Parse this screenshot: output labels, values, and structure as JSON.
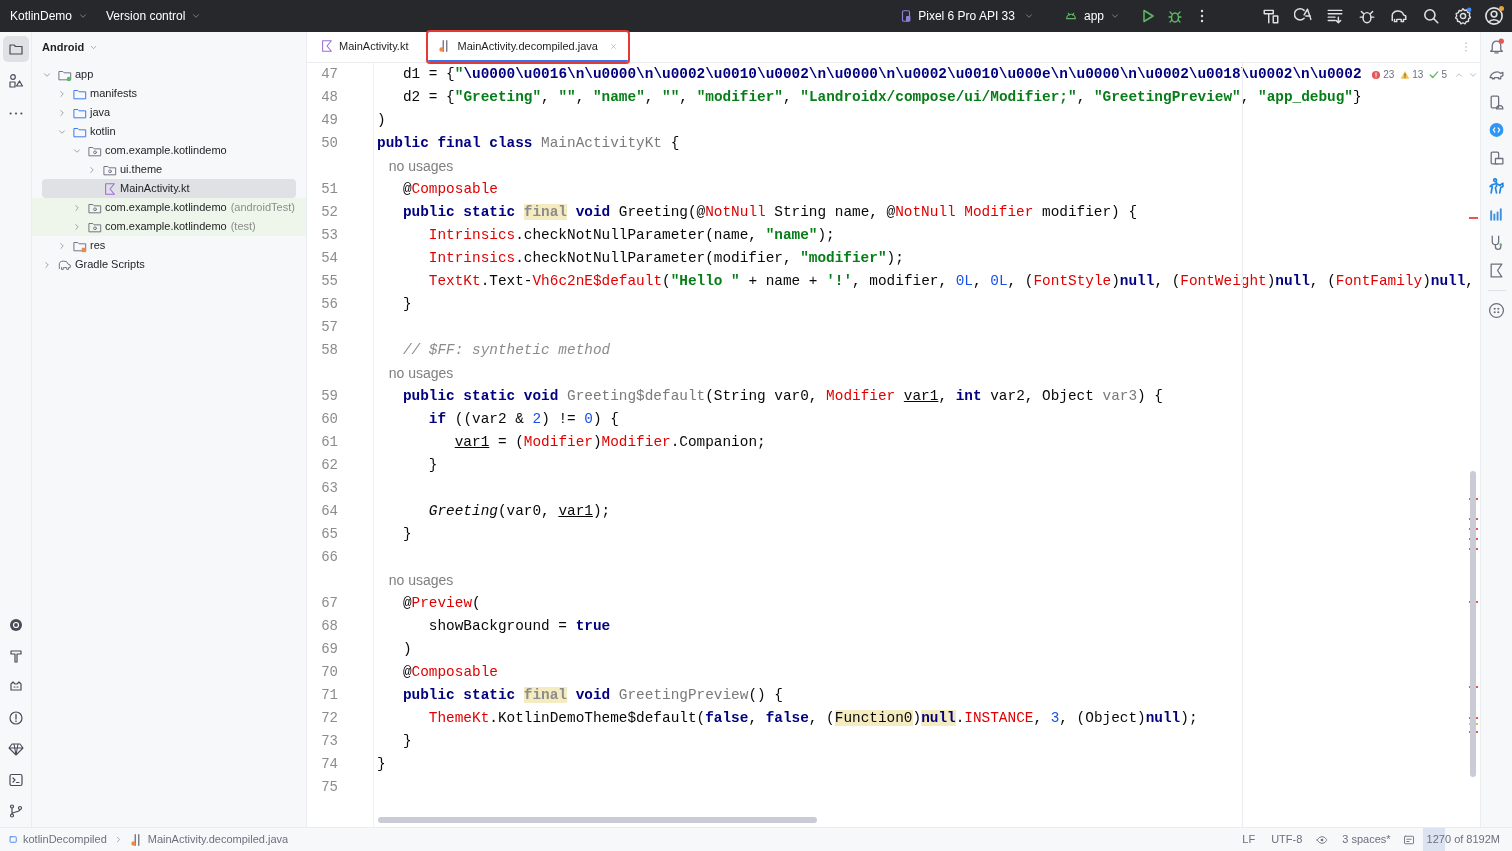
{
  "title_bar": {
    "project": "KotlinDemo",
    "vcs": "Version control",
    "device": "Pixel 6 Pro API 33",
    "run_config": "app"
  },
  "left_tools": [
    {
      "kind": "project",
      "selected": true
    },
    {
      "kind": "resources",
      "selected": false
    },
    {
      "kind": "more",
      "selected": false
    }
  ],
  "project_view": {
    "title": "Android",
    "tree": [
      {
        "label": "app",
        "kind": "module",
        "expanded": true,
        "selected": false,
        "test_source": false,
        "children": [
          {
            "label": "manifests",
            "kind": "folder",
            "expanded": false,
            "selected": false,
            "test_source": false
          },
          {
            "label": "java",
            "kind": "folder",
            "expanded": false,
            "selected": false,
            "test_source": false
          },
          {
            "label": "kotlin",
            "kind": "folder",
            "expanded": true,
            "selected": false,
            "test_source": false,
            "children": [
              {
                "label": "com.example.kotlindemo",
                "kind": "package",
                "expanded": true,
                "selected": false,
                "test_source": false,
                "children": [
                  {
                    "label": "ui.theme",
                    "kind": "package",
                    "expanded": false,
                    "selected": false,
                    "test_source": false
                  },
                  {
                    "label": "MainActivity.kt",
                    "kind": "kotlin-file",
                    "selected": true,
                    "test_source": false
                  }
                ]
              },
              {
                "label": "com.example.kotlindemo",
                "suffix": "(androidTest)",
                "kind": "package",
                "expanded": false,
                "selected": false,
                "test_source": true
              },
              {
                "label": "com.example.kotlindemo",
                "suffix": "(test)",
                "kind": "package",
                "expanded": false,
                "selected": false,
                "test_source": true
              }
            ]
          },
          {
            "label": "res",
            "kind": "res-folder",
            "expanded": false,
            "selected": false,
            "test_source": false
          }
        ]
      },
      {
        "label": "Gradle Scripts",
        "kind": "gradle",
        "expanded": false,
        "selected": false,
        "test_source": false
      }
    ]
  },
  "editor": {
    "tabs": [
      {
        "label": "MainActivity.kt",
        "kind": "kotlin-file",
        "selected": false,
        "outlined": false
      },
      {
        "label": "MainActivity.decompiled.java",
        "kind": "java-file",
        "selected": true,
        "outlined": true
      }
    ],
    "inspections": {
      "errors": "23",
      "warnings": "13",
      "weak_warnings": "5"
    },
    "lines": [
      {
        "kind": "code",
        "number": "47",
        "tokens": [
          {
            "kind": "plain",
            "text": "   d1 = {"
          },
          {
            "kind": "str",
            "text": "\""
          },
          {
            "kind": "esc",
            "text": "\\u0000\\u0016\\n\\u0000\\n\\u0002\\u0010\\u0002\\n\\u0000\\n\\u0002\\u0010\\u000e\\n\\u0000\\n\\u0002\\u0018\\u0002\\n\\u0002"
          }
        ]
      },
      {
        "kind": "code",
        "number": "48",
        "tokens": [
          {
            "kind": "plain",
            "text": "   d2 = {"
          },
          {
            "kind": "str",
            "text": "\"Greeting\""
          },
          {
            "kind": "plain",
            "text": ", "
          },
          {
            "kind": "str",
            "text": "\"\""
          },
          {
            "kind": "plain",
            "text": ", "
          },
          {
            "kind": "str",
            "text": "\"name\""
          },
          {
            "kind": "plain",
            "text": ", "
          },
          {
            "kind": "str",
            "text": "\"\""
          },
          {
            "kind": "plain",
            "text": ", "
          },
          {
            "kind": "str",
            "text": "\"modifier\""
          },
          {
            "kind": "plain",
            "text": ", "
          },
          {
            "kind": "str",
            "text": "\"Landroidx/compose/ui/Modifier;\""
          },
          {
            "kind": "plain",
            "text": ", "
          },
          {
            "kind": "str",
            "text": "\"GreetingPreview\""
          },
          {
            "kind": "plain",
            "text": ", "
          },
          {
            "kind": "str",
            "text": "\"app_debug\""
          },
          {
            "kind": "plain",
            "text": "}"
          }
        ]
      },
      {
        "kind": "code",
        "number": "49",
        "tokens": [
          {
            "kind": "plain",
            "text": ")"
          }
        ]
      },
      {
        "kind": "code",
        "number": "50",
        "tokens": [
          {
            "kind": "kw",
            "text": "public final class "
          },
          {
            "kind": "gray",
            "text": "MainActivityKt"
          },
          {
            "kind": "plain",
            "text": " {"
          }
        ]
      },
      {
        "kind": "hint",
        "text": "   no usages"
      },
      {
        "kind": "code",
        "number": "51",
        "tokens": [
          {
            "kind": "plain",
            "text": "   @"
          },
          {
            "kind": "ann",
            "text": "Composable"
          }
        ]
      },
      {
        "kind": "code",
        "number": "52",
        "tokens": [
          {
            "kind": "kw",
            "text": "   public static "
          },
          {
            "kind": "final-hl",
            "text": "final"
          },
          {
            "kind": "kw",
            "text": " void"
          },
          {
            "kind": "plain",
            "text": " Greeting(@"
          },
          {
            "kind": "ann",
            "text": "NotNull"
          },
          {
            "kind": "plain",
            "text": " String name, @"
          },
          {
            "kind": "ann",
            "text": "NotNull"
          },
          {
            "kind": "ann",
            "text": " Modifier"
          },
          {
            "kind": "plain",
            "text": " modifier) {"
          }
        ]
      },
      {
        "kind": "code",
        "number": "53",
        "tokens": [
          {
            "kind": "ann",
            "text": "      Intrinsics"
          },
          {
            "kind": "plain",
            "text": ".checkNotNullParameter(name, "
          },
          {
            "kind": "str",
            "text": "\"name\""
          },
          {
            "kind": "plain",
            "text": ");"
          }
        ]
      },
      {
        "kind": "code",
        "number": "54",
        "tokens": [
          {
            "kind": "ann",
            "text": "      Intrinsics"
          },
          {
            "kind": "plain",
            "text": ".checkNotNullParameter(modifier, "
          },
          {
            "kind": "str",
            "text": "\"modifier\""
          },
          {
            "kind": "plain",
            "text": ");"
          }
        ]
      },
      {
        "kind": "code",
        "number": "55",
        "tokens": [
          {
            "kind": "ann",
            "text": "      TextKt"
          },
          {
            "kind": "plain",
            "text": ".Text-"
          },
          {
            "kind": "ann",
            "text": "Vh6c2nE$default"
          },
          {
            "kind": "plain",
            "text": "("
          },
          {
            "kind": "str",
            "text": "\"Hello \""
          },
          {
            "kind": "plain",
            "text": " + name + "
          },
          {
            "kind": "str",
            "text": "'!'"
          },
          {
            "kind": "plain",
            "text": ", modifier, "
          },
          {
            "kind": "num",
            "text": "0L"
          },
          {
            "kind": "plain",
            "text": ", "
          },
          {
            "kind": "num",
            "text": "0L"
          },
          {
            "kind": "plain",
            "text": ", ("
          },
          {
            "kind": "ann",
            "text": "FontStyle"
          },
          {
            "kind": "plain",
            "text": ")"
          },
          {
            "kind": "kw",
            "text": "null"
          },
          {
            "kind": "plain",
            "text": ", ("
          },
          {
            "kind": "ann",
            "text": "FontWeight"
          },
          {
            "kind": "plain",
            "text": ")"
          },
          {
            "kind": "kw",
            "text": "null"
          },
          {
            "kind": "plain",
            "text": ", ("
          },
          {
            "kind": "ann",
            "text": "FontFamily"
          },
          {
            "kind": "plain",
            "text": ")"
          },
          {
            "kind": "kw",
            "text": "null"
          },
          {
            "kind": "plain",
            "text": ","
          }
        ]
      },
      {
        "kind": "code",
        "number": "56",
        "tokens": [
          {
            "kind": "plain",
            "text": "   }"
          }
        ]
      },
      {
        "kind": "code",
        "number": "57"
      },
      {
        "kind": "code",
        "number": "58",
        "tokens": [
          {
            "kind": "comment",
            "text": "   // $FF: synthetic method"
          }
        ]
      },
      {
        "kind": "hint",
        "text": "   no usages"
      },
      {
        "kind": "code",
        "number": "59",
        "tokens": [
          {
            "kind": "kw",
            "text": "   public static void "
          },
          {
            "kind": "gray",
            "text": "Greeting$default"
          },
          {
            "kind": "plain",
            "text": "(String var0, "
          },
          {
            "kind": "ann",
            "text": "Modifier"
          },
          {
            "kind": "var",
            "text": " var1"
          },
          {
            "kind": "plain",
            "text": ", "
          },
          {
            "kind": "kw",
            "text": "int"
          },
          {
            "kind": "plain",
            "text": " var2, Object "
          },
          {
            "kind": "gray",
            "text": "var3"
          },
          {
            "kind": "plain",
            "text": ") {"
          }
        ]
      },
      {
        "kind": "code",
        "number": "60",
        "tokens": [
          {
            "kind": "kw",
            "text": "      if"
          },
          {
            "kind": "plain",
            "text": " ((var2 & "
          },
          {
            "kind": "num",
            "text": "2"
          },
          {
            "kind": "plain",
            "text": ") != "
          },
          {
            "kind": "num",
            "text": "0"
          },
          {
            "kind": "plain",
            "text": ") {"
          }
        ]
      },
      {
        "kind": "code",
        "number": "61",
        "tokens": [
          {
            "kind": "var",
            "text": "         var1"
          },
          {
            "kind": "plain",
            "text": " = ("
          },
          {
            "kind": "ann",
            "text": "Modifier"
          },
          {
            "kind": "plain",
            "text": ")"
          },
          {
            "kind": "ann",
            "text": "Modifier"
          },
          {
            "kind": "plain",
            "text": ".Companion;"
          }
        ]
      },
      {
        "kind": "code",
        "number": "62",
        "tokens": [
          {
            "kind": "plain",
            "text": "      }"
          }
        ]
      },
      {
        "kind": "code",
        "number": "63"
      },
      {
        "kind": "code",
        "number": "64",
        "tokens": [
          {
            "kind": "italic",
            "text": "      Greeting"
          },
          {
            "kind": "plain",
            "text": "(var0, "
          },
          {
            "kind": "var",
            "text": "var1"
          },
          {
            "kind": "plain",
            "text": ");"
          }
        ]
      },
      {
        "kind": "code",
        "number": "65",
        "tokens": [
          {
            "kind": "plain",
            "text": "   }"
          }
        ]
      },
      {
        "kind": "code",
        "number": "66"
      },
      {
        "kind": "hint",
        "text": "   no usages"
      },
      {
        "kind": "code",
        "number": "67",
        "tokens": [
          {
            "kind": "plain",
            "text": "   @"
          },
          {
            "kind": "ann",
            "text": "Preview"
          },
          {
            "kind": "plain",
            "text": "("
          }
        ]
      },
      {
        "kind": "code",
        "number": "68",
        "tokens": [
          {
            "kind": "plain",
            "text": "      showBackground = "
          },
          {
            "kind": "kw",
            "text": "true"
          }
        ]
      },
      {
        "kind": "code",
        "number": "69",
        "tokens": [
          {
            "kind": "plain",
            "text": "   )"
          }
        ]
      },
      {
        "kind": "code",
        "number": "70",
        "tokens": [
          {
            "kind": "plain",
            "text": "   @"
          },
          {
            "kind": "ann",
            "text": "Composable"
          }
        ]
      },
      {
        "kind": "code",
        "number": "71",
        "tokens": [
          {
            "kind": "kw",
            "text": "   public static "
          },
          {
            "kind": "final-hl",
            "text": "final"
          },
          {
            "kind": "kw",
            "text": " void"
          },
          {
            "kind": "gray",
            "text": " GreetingPreview"
          },
          {
            "kind": "plain",
            "text": "() {"
          }
        ]
      },
      {
        "kind": "code",
        "number": "72",
        "tokens": [
          {
            "kind": "ann",
            "text": "      ThemeKt"
          },
          {
            "kind": "plain",
            "text": ".KotlinDemoTheme$default("
          },
          {
            "kind": "kw",
            "text": "false"
          },
          {
            "kind": "plain",
            "text": ", "
          },
          {
            "kind": "kw",
            "text": "false"
          },
          {
            "kind": "plain",
            "text": ", ("
          },
          {
            "kind": "plain-hl",
            "text": "Function0"
          },
          {
            "kind": "plain",
            "text": ")"
          },
          {
            "kind": "kw-hl",
            "text": "null"
          },
          {
            "kind": "plain",
            "text": "."
          },
          {
            "kind": "ann",
            "text": "INSTANCE"
          },
          {
            "kind": "plain",
            "text": ", "
          },
          {
            "kind": "num",
            "text": "3"
          },
          {
            "kind": "plain",
            "text": ", (Object)"
          },
          {
            "kind": "kw",
            "text": "null"
          },
          {
            "kind": "plain",
            "text": ");"
          }
        ]
      },
      {
        "kind": "code",
        "number": "73",
        "tokens": [
          {
            "kind": "plain",
            "text": "   }"
          }
        ]
      },
      {
        "kind": "code",
        "number": "74",
        "tokens": [
          {
            "kind": "plain",
            "text": "}"
          }
        ]
      },
      {
        "kind": "code",
        "number": "75"
      }
    ]
  },
  "status_bar": {
    "breadcrumbs": [
      {
        "kind": "module",
        "text": "kotlinDecompiled"
      },
      {
        "kind": "java-file",
        "text": "MainActivity.decompiled.java"
      }
    ],
    "line_separator": "LF",
    "encoding": "UTF-8",
    "indent": "3 spaces*",
    "memory": {
      "text": "1270 of 8192M",
      "level": 0.28
    }
  }
}
